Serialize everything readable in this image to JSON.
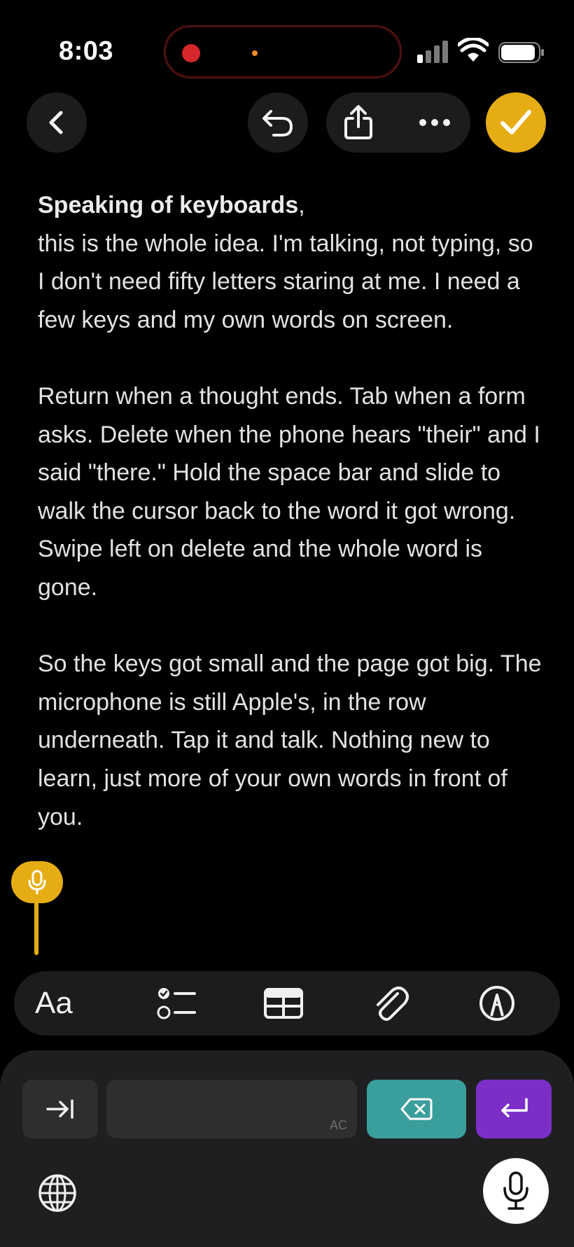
{
  "status_bar": {
    "time": "8:03"
  },
  "toolbar": {
    "back_icon": "chevron-left-icon",
    "undo_icon": "undo-icon",
    "share_icon": "share-icon",
    "more_icon": "ellipsis-icon",
    "done_icon": "checkmark-icon",
    "accent_color": "#E6AC14"
  },
  "note": {
    "title": "Speaking of keyboards",
    "title_suffix": ",",
    "paragraphs": [
      "this is the whole idea. I'm talking, not typing, so I don't need fifty letters staring at me. I need a few keys and my own words on screen.",
      "Return when a thought ends. Tab when a form asks. Delete when the phone hears \"their\" and I said \"there.\" Hold the space bar and slide to walk the cursor back to the word it got wrong. Swipe left on delete and the whole word is gone.",
      "So the keys got small and the page got big. The microphone is still Apple's, in the row underneath. Tap it and talk. Nothing new to learn, just more of your own words in front of you."
    ]
  },
  "format_bar": {
    "text_style_label": "Aa",
    "icons": [
      "checklist-icon",
      "table-icon",
      "attachment-icon",
      "markup-icon"
    ]
  },
  "keyboard": {
    "space_hint": "AC",
    "delete_color": "#3A9E9C",
    "return_color": "#7C2FC7"
  }
}
